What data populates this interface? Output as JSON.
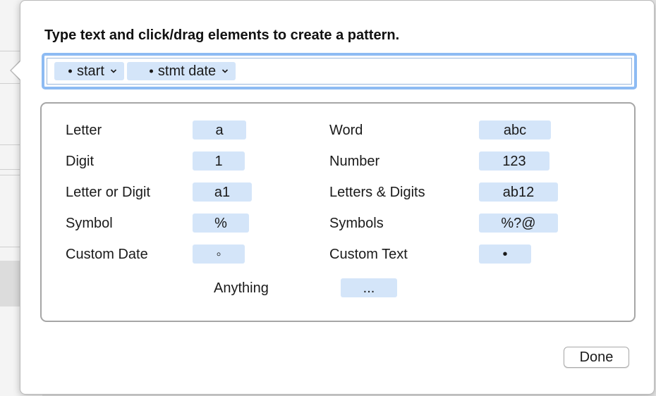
{
  "popover": {
    "instruction": "Type text and click/drag elements to create a pattern.",
    "pattern_tokens": [
      {
        "label": "start",
        "icon": "chevron-down-icon"
      },
      {
        "label": "stmt date",
        "icon": "chevron-down-icon"
      }
    ],
    "palette": {
      "left": [
        {
          "label": "Letter",
          "chip": "a"
        },
        {
          "label": "Digit",
          "chip": "1"
        },
        {
          "label": "Letter or Digit",
          "chip": "a1"
        },
        {
          "label": "Symbol",
          "chip": "%"
        },
        {
          "label": "Custom Date",
          "chip": "◦"
        }
      ],
      "right": [
        {
          "label": "Word",
          "chip": "abc"
        },
        {
          "label": "Number",
          "chip": "123"
        },
        {
          "label": "Letters & Digits",
          "chip": "ab12"
        },
        {
          "label": "Symbols",
          "chip": "%?@"
        },
        {
          "label": "Custom Text",
          "chip": "•"
        }
      ],
      "anything": {
        "label": "Anything",
        "chip": "..."
      }
    },
    "done_label": "Done"
  },
  "colors": {
    "token_bg": "#d4e5f9",
    "focus_ring": "#8dbbf3",
    "border": "#a6a6a6"
  }
}
